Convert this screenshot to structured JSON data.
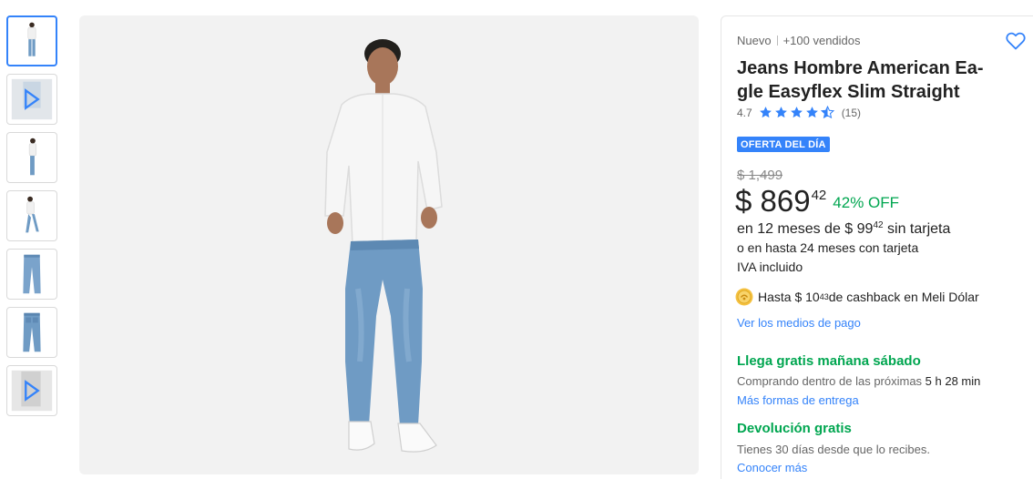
{
  "product": {
    "condition": "Nuevo",
    "sold": "+100 vendidos",
    "title": "Jeans Hombre American Eagle Easyflex Slim Straight",
    "title_line1": "Jeans Hombre American Ea-",
    "title_line2": "gle Easyflex Slim Straight",
    "rating": "4.7",
    "rating_value": 4.7,
    "review_count": "(15)"
  },
  "promo": {
    "badge": "OFERTA DEL DÍA"
  },
  "pricing": {
    "old_price": "$ 1,499",
    "currency": "$",
    "price_integer": "869",
    "price_cents": "42",
    "discount": "42% OFF",
    "installments_prefix": "en 12 meses de $ 99",
    "installments_cents": "42",
    "installments_suffix": " sin tarjeta",
    "card_installments": "o en hasta 24 meses con tarjeta",
    "tax": "IVA incluido"
  },
  "cashback": {
    "prefix": "Hasta $ 10",
    "cents": "43",
    "suffix": " de cashback en Meli Dólar"
  },
  "links": {
    "payment_methods": "Ver los medios de pago",
    "more_delivery": "Más formas de entrega",
    "learn_more": "Conocer más"
  },
  "shipping": {
    "headline": "Llega gratis mañana sábado",
    "countdown_prefix": "Comprando dentro de las próximas ",
    "countdown_time": "5 h 28 min"
  },
  "returns": {
    "headline": "Devolución gratis",
    "detail": "Tienes 30 días desde que lo recibes."
  },
  "gallery": {
    "thumbnails": [
      {
        "kind": "photo-front",
        "selected": true
      },
      {
        "kind": "video",
        "selected": false
      },
      {
        "kind": "photo-side",
        "selected": false
      },
      {
        "kind": "photo-walking",
        "selected": false
      },
      {
        "kind": "jeans-front",
        "selected": false
      },
      {
        "kind": "jeans-back",
        "selected": false
      },
      {
        "kind": "video",
        "selected": false
      }
    ]
  },
  "colors": {
    "accent": "#3483fa",
    "success": "#00a650",
    "denim": "#6f9bc4",
    "shirt": "#f5f5f5",
    "background": "#f2f2f2"
  },
  "icons": {
    "favorite": "heart-icon",
    "star": "star-icon",
    "coin": "meli-dolar-coin-icon",
    "play": "play-icon"
  }
}
